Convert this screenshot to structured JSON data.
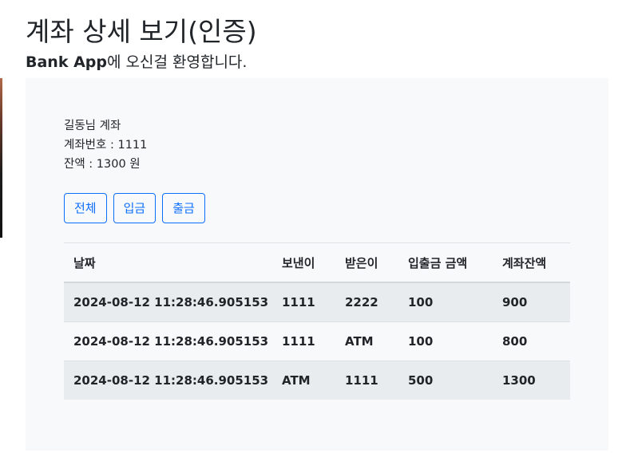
{
  "page": {
    "title": "계좌 상세 보기(인증)",
    "welcome_brand": "Bank App",
    "welcome_text": "에 오신걸 환영합니다."
  },
  "account": {
    "owner_line": "길동님 계좌",
    "number_line": "계좌번호 : 1111",
    "balance_line": "잔액 : 1300 원"
  },
  "filters": {
    "all_label": "전체",
    "deposit_label": "입금",
    "withdraw_label": "출금"
  },
  "table": {
    "headers": [
      "날짜",
      "보낸이",
      "받은이",
      "입출금 금액",
      "계좌잔액"
    ],
    "rows": [
      [
        "2024-08-12 11:28:46.905153",
        "1111",
        "2222",
        "100",
        "900"
      ],
      [
        "2024-08-12 11:28:46.905153",
        "1111",
        "ATM",
        "100",
        "800"
      ],
      [
        "2024-08-12 11:28:46.905153",
        "ATM",
        "1111",
        "500",
        "1300"
      ]
    ]
  },
  "colors": {
    "accent": "#0d6efd",
    "panel_bg": "#f8f9fa",
    "stripe": "#e9ecef"
  }
}
